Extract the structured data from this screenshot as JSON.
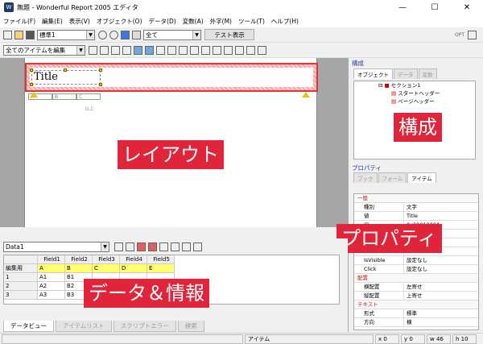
{
  "window": {
    "title": "無題 - Wonderful Report 2005 エディタ",
    "minimize": "—",
    "maximize": "☐",
    "close": "✕"
  },
  "menu": [
    "ファイル(F)",
    "編集(E)",
    "表示(V)",
    "オブジェクト(O)",
    "データ(D)",
    "変数(A)",
    "外字(M)",
    "ツール(T)",
    "ヘルプ(H)"
  ],
  "toolbar1": {
    "style_combo": "標準1",
    "filter_combo": "全て",
    "preview_button": "テスト表示",
    "opt_label": "OPT"
  },
  "toolbar2": {
    "edit_scope_combo": "全てのアイテムを編集"
  },
  "layout": {
    "title_item": "Title",
    "header_cells": [
      "A",
      "B",
      "C"
    ],
    "total_label": "以上",
    "overlay_label": "レイアウト"
  },
  "structure": {
    "panel_title": "構成",
    "tabs": [
      "オブジェクト",
      "データ",
      "変数"
    ],
    "tree": [
      "セクション1",
      "スタートヘッダー",
      "ページヘッダー"
    ],
    "overlay_label": "構成"
  },
  "properties": {
    "panel_title": "プロパティ",
    "tabs": [
      "ブック",
      "フォーム",
      "アイテム"
    ],
    "rows": [
      {
        "cat": "一般"
      },
      {
        "k": "種別",
        "v": "文字"
      },
      {
        "k": "値",
        "v": "Title"
      },
      {
        "k": "ID",
        "v": "0x0001000A"
      },
      {
        "k": "名前",
        "v": ""
      },
      {
        "k": "",
        "v": ""
      },
      {
        "k": "",
        "v": ""
      },
      {
        "k": "IsVisible",
        "v": "設定なし"
      },
      {
        "k": "Click",
        "v": "設定なし"
      },
      {
        "cat": "配置"
      },
      {
        "k": "横配置",
        "v": "左寄せ"
      },
      {
        "k": "縦配置",
        "v": "上寄せ"
      },
      {
        "cat": "テキスト"
      },
      {
        "k": "形式",
        "v": "標準"
      },
      {
        "k": "方向",
        "v": "横"
      }
    ],
    "overlay_label": "プロパティ"
  },
  "data_view": {
    "dataset_combo": "Data1",
    "columns": [
      "",
      "Field1",
      "Field2",
      "Field3",
      "Field4",
      "Field5"
    ],
    "rows": [
      [
        "編集用",
        "A",
        "B",
        "C",
        "D",
        "E"
      ],
      [
        "1",
        "A1",
        "B1",
        "",
        "",
        ""
      ],
      [
        "2",
        "A2",
        "B2",
        "",
        "",
        ""
      ],
      [
        "3",
        "A3",
        "B3",
        "",
        "",
        ""
      ]
    ],
    "overlay_label": "データ＆情報"
  },
  "bottom_tabs": [
    "データビュー",
    "アイテムリスト",
    "スクリプトエラー",
    "検索"
  ],
  "status": {
    "item": "アイテム",
    "x": "x 0",
    "y": "y 0",
    "w": "w 46",
    "h": "h 10"
  }
}
